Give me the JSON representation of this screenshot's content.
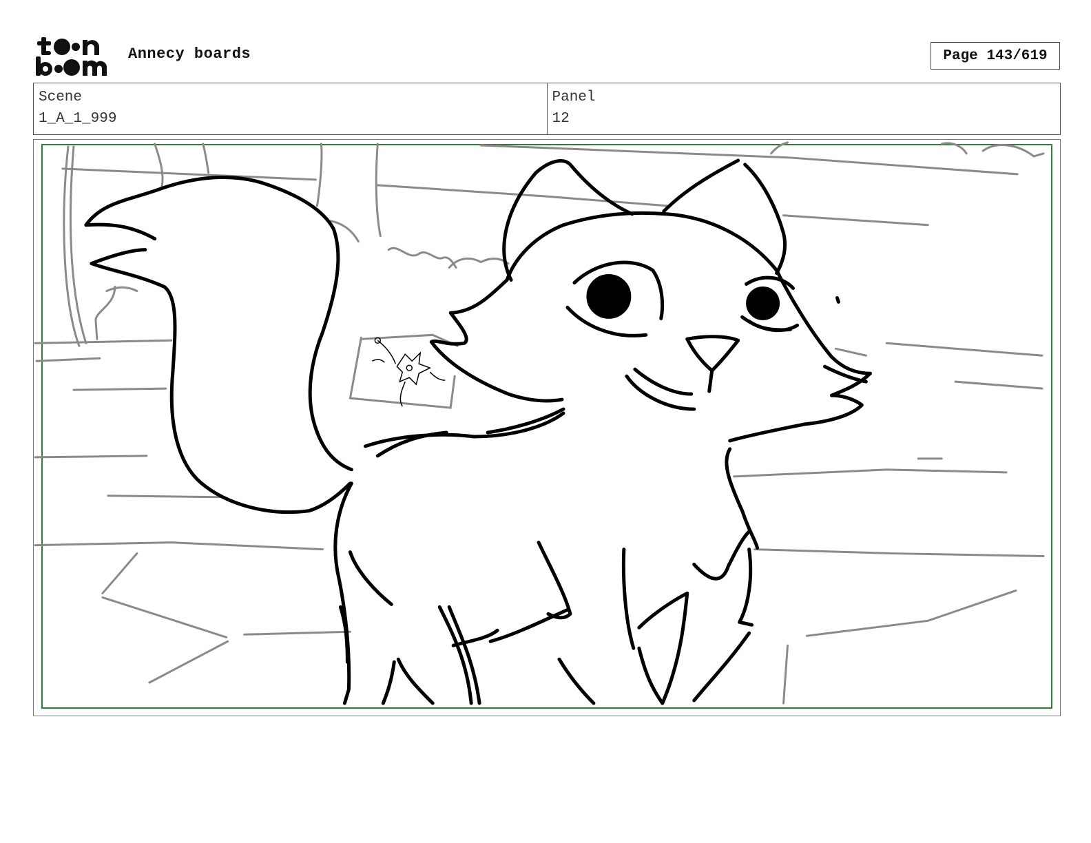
{
  "header": {
    "logo_top": "toon",
    "logo_bottom": "boom",
    "title": "Annecy boards",
    "page": "Page 143/619"
  },
  "info": {
    "scene_label": "Scene",
    "scene_value": "1_A_1_999",
    "panel_label": "Panel",
    "panel_value": "12"
  },
  "colors": {
    "safe_frame": "#2e7d32",
    "ink": "#000000",
    "background_sketch": "#8a8a8a"
  }
}
